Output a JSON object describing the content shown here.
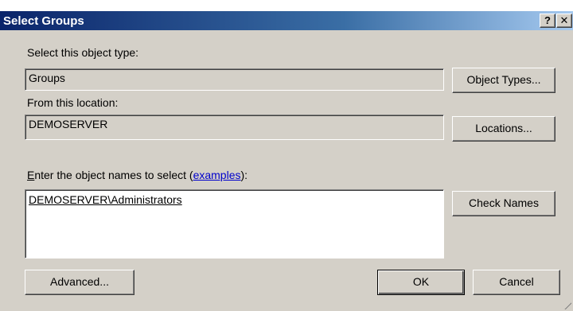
{
  "window": {
    "title": "Select Groups",
    "help_label": "?",
    "close_label": "✕"
  },
  "object_type": {
    "label": "Select this object type:",
    "value": "Groups",
    "button": "Object Types..."
  },
  "location": {
    "label": "From this location:",
    "value": "DEMOSERVER",
    "button": "Locations..."
  },
  "names": {
    "label_prefix_accesskey": "E",
    "label_prefix_rest": "nter the object names to select (",
    "examples_link": "examples",
    "label_suffix": "):",
    "value": "DEMOSERVER\\Administrators",
    "check_button": "Check Names"
  },
  "footer": {
    "advanced": "Advanced...",
    "ok": "OK",
    "cancel": "Cancel"
  }
}
